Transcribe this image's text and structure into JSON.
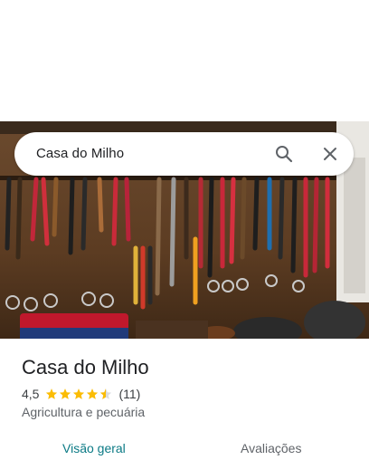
{
  "search": {
    "query": "Casa do Milho"
  },
  "place": {
    "name": "Casa do Milho",
    "rating": "4,5",
    "rating_value": 4.5,
    "review_count": "(11)",
    "category": "Agricultura e pecuária"
  },
  "tabs": [
    {
      "label": "Visão geral",
      "active": true
    },
    {
      "label": "Avaliações",
      "active": false
    }
  ],
  "colors": {
    "star": "#fbbc04",
    "active_tab": "#0b7a85",
    "text_secondary": "#5f6368"
  },
  "icons": {
    "search": "search-icon",
    "close": "close-icon",
    "star": "star-icon"
  }
}
